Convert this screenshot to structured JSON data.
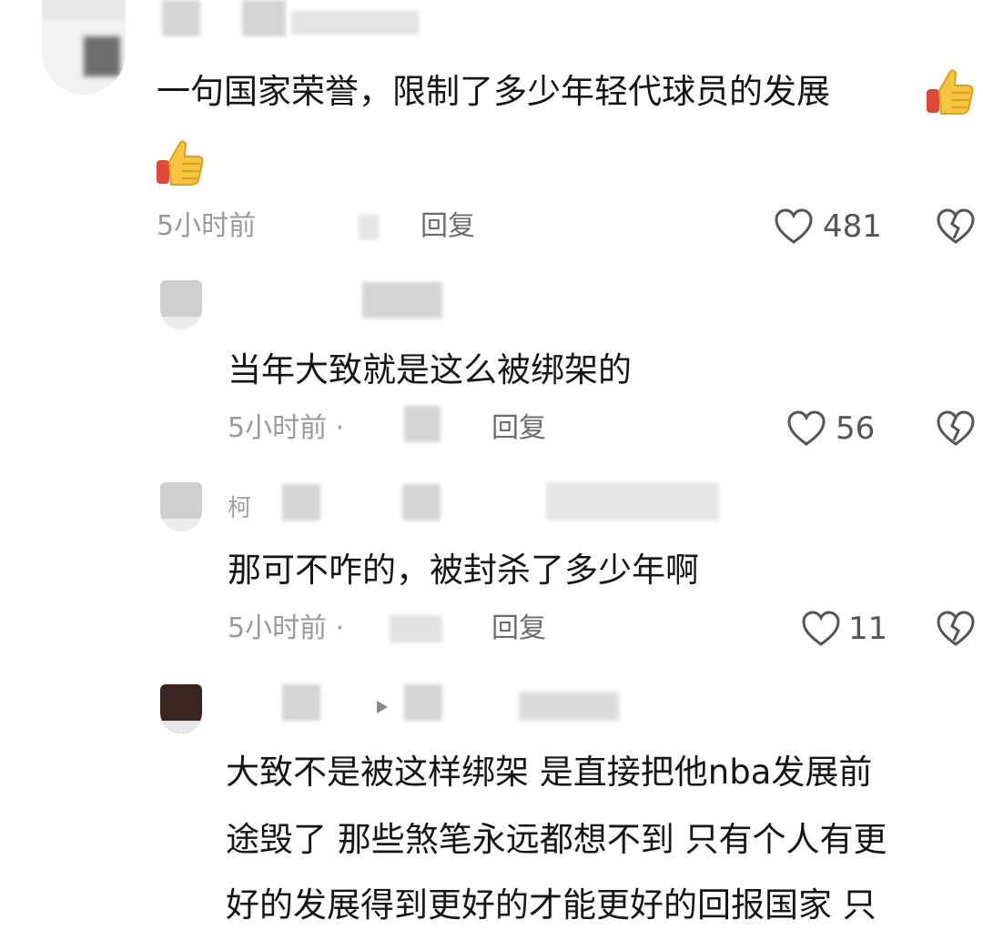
{
  "comments": [
    {
      "text": "一句国家荣誉，限制了多少年轻代球员的发展",
      "time": "5小时前",
      "reply": "回复",
      "likes": "481"
    },
    {
      "text": "当年大致就是这么被绑架的",
      "time": "5小时前 ·",
      "reply": "回复",
      "likes": "56"
    },
    {
      "author_prefix": "柯",
      "text": "那可不咋的，被封杀了多少年啊",
      "time": "5小时前 ·",
      "reply": "回复",
      "likes": "11"
    },
    {
      "lines": [
        "大致不是被这样绑架 是直接把他nba发展前",
        "途毁了 那些煞笔永远都想不到 只有个人有更",
        "好的发展得到更好的才能更好的回报国家 只"
      ]
    }
  ],
  "icons": {
    "thumbs_up": "thumbs-up-emoji",
    "like": "heart-outline-icon",
    "dislike": "broken-heart-icon"
  },
  "colors": {
    "text": "#161616",
    "meta": "#9a9a9a",
    "icon": "#555555",
    "thumb_yellow": "#f5c542",
    "thumb_red": "#e0483a"
  }
}
